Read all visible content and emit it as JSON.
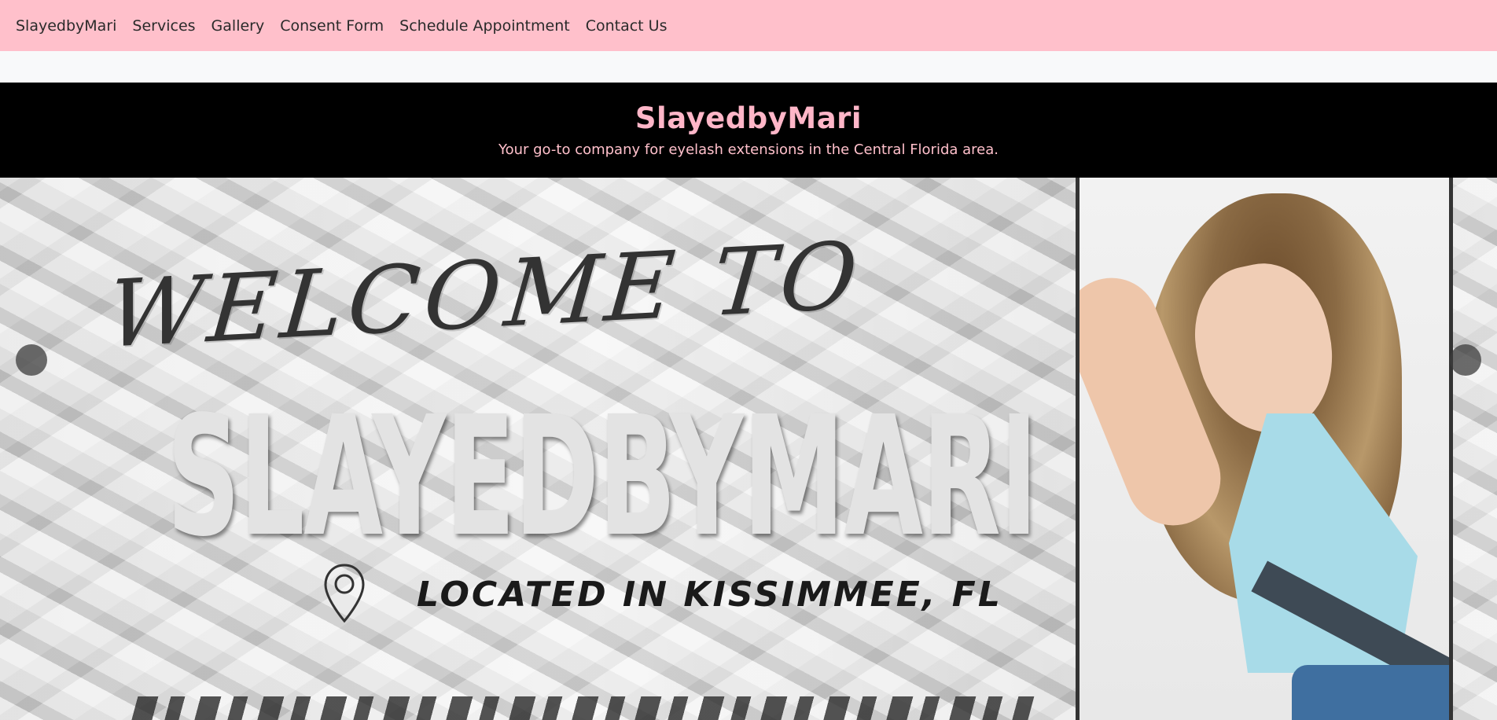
{
  "nav": {
    "brand": "SlayedbyMari",
    "links": [
      "Services",
      "Gallery",
      "Consent Form",
      "Schedule Appointment",
      "Contact Us"
    ]
  },
  "header": {
    "title": "SlayedbyMari",
    "subtitle": "Your go-to company for eyelash extensions in the Central Florida area."
  },
  "carousel": {
    "slide": {
      "welcome": "WELCOME TO",
      "brand": "SLAYEDBYMARI",
      "location": "LOCATED IN KISSIMMEE, FL"
    },
    "controls": {
      "prev_icon": "chevron-left-icon",
      "next_icon": "chevron-right-icon"
    }
  },
  "colors": {
    "navbar_bg": "#ffc0cb",
    "header_bg": "#000000",
    "header_title": "#ffb6c8",
    "strip_bg": "#f8f9fa"
  }
}
